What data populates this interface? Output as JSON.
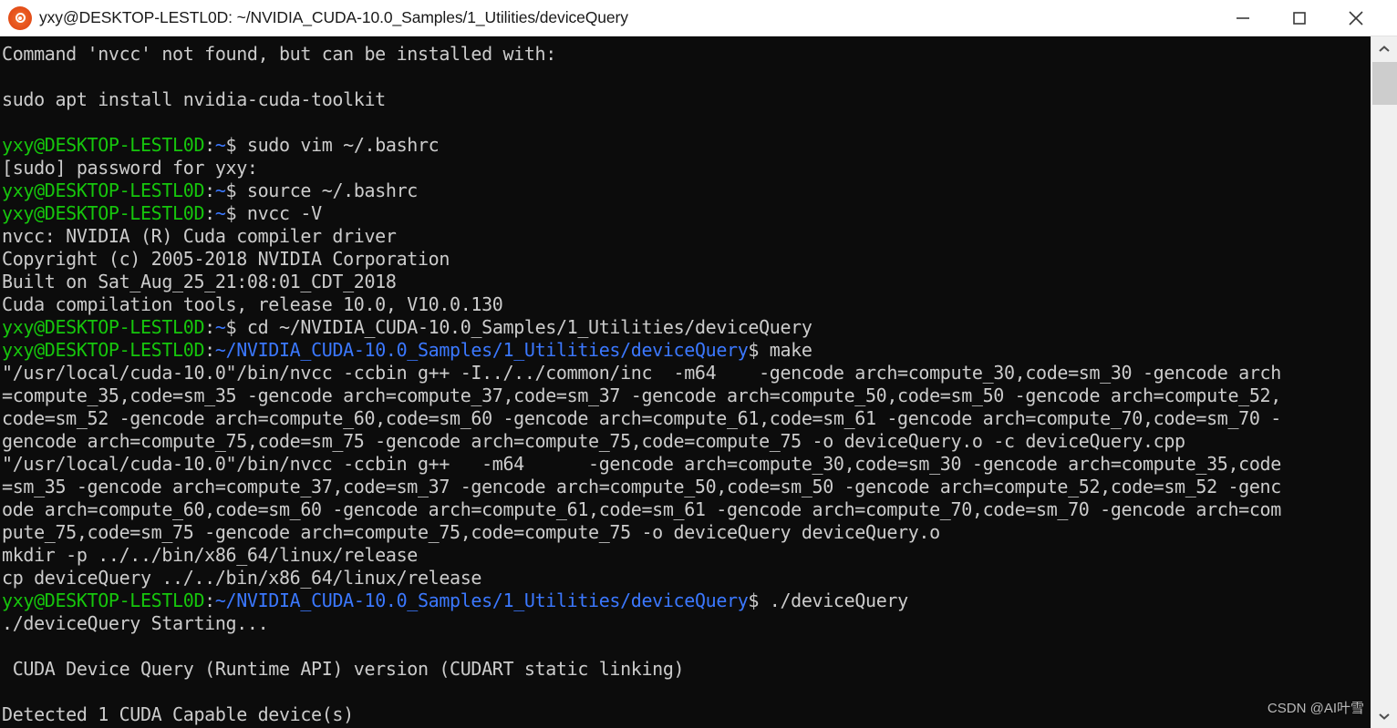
{
  "window": {
    "title": "yxy@DESKTOP-LESTL0D: ~/NVIDIA_CUDA-10.0_Samples/1_Utilities/deviceQuery",
    "icon": "ubuntu-icon",
    "minimize_label": "—",
    "maximize_label": "□",
    "close_label": "✕"
  },
  "colors": {
    "terminal_bg": "#0c0c0c",
    "text": "#cccccc",
    "prompt_user": "#16c60c",
    "prompt_path": "#3b78ff",
    "titlebar_bg": "#ffffff",
    "accent_orange": "#d98c00"
  },
  "scrollbar": {
    "up_arrow": "chevron-up-icon",
    "down_arrow": "chevron-down-icon",
    "thumb": "scrollbar-thumb"
  },
  "watermark": {
    "text": "CSDN @AI叶雪"
  },
  "terminal": {
    "prompt_user_host": "yxy@DESKTOP-LESTL0D",
    "prompt_home": ":~$ ",
    "prompt_dir_path": "~/NVIDIA_CUDA-10.0_Samples/1_Utilities/deviceQuery",
    "lines": [
      {
        "segments": [
          {
            "t": "Command 'nvcc' not found, but can be installed with:",
            "c": "w"
          }
        ]
      },
      {
        "segments": [
          {
            "t": "",
            "c": "w"
          }
        ]
      },
      {
        "segments": [
          {
            "t": "sudo apt install nvidia-cuda-toolkit",
            "c": "w"
          }
        ]
      },
      {
        "segments": [
          {
            "t": "",
            "c": "w"
          }
        ]
      },
      {
        "segments": [
          {
            "t": "yxy@DESKTOP-LESTL0D",
            "c": "g"
          },
          {
            "t": ":",
            "c": "w"
          },
          {
            "t": "~",
            "c": "b"
          },
          {
            "t": "$ sudo vim ~/.bashrc",
            "c": "w"
          }
        ]
      },
      {
        "segments": [
          {
            "t": "[sudo] password for yxy:",
            "c": "w"
          }
        ]
      },
      {
        "segments": [
          {
            "t": "yxy@DESKTOP-LESTL0D",
            "c": "g"
          },
          {
            "t": ":",
            "c": "w"
          },
          {
            "t": "~",
            "c": "b"
          },
          {
            "t": "$ source ~/.bashrc",
            "c": "w"
          }
        ]
      },
      {
        "segments": [
          {
            "t": "yxy@DESKTOP-LESTL0D",
            "c": "g"
          },
          {
            "t": ":",
            "c": "w"
          },
          {
            "t": "~",
            "c": "b"
          },
          {
            "t": "$ nvcc -V",
            "c": "w"
          }
        ]
      },
      {
        "segments": [
          {
            "t": "nvcc: NVIDIA (R) Cuda compiler driver",
            "c": "w"
          }
        ]
      },
      {
        "segments": [
          {
            "t": "Copyright (c) 2005-2018 NVIDIA Corporation",
            "c": "w"
          }
        ]
      },
      {
        "segments": [
          {
            "t": "Built on Sat_Aug_25_21:08:01_CDT_2018",
            "c": "w"
          }
        ]
      },
      {
        "segments": [
          {
            "t": "Cuda compilation tools, release 10.0, V10.0.130",
            "c": "w"
          }
        ]
      },
      {
        "segments": [
          {
            "t": "yxy@DESKTOP-LESTL0D",
            "c": "g"
          },
          {
            "t": ":",
            "c": "w"
          },
          {
            "t": "~",
            "c": "b"
          },
          {
            "t": "$ cd ~/NVIDIA_CUDA-10.0_Samples/1_Utilities/deviceQuery",
            "c": "w"
          }
        ]
      },
      {
        "segments": [
          {
            "t": "yxy@DESKTOP-LESTL0D",
            "c": "g"
          },
          {
            "t": ":",
            "c": "w"
          },
          {
            "t": "~/NVIDIA_CUDA-10.0_Samples/1_Utilities/deviceQuery",
            "c": "b"
          },
          {
            "t": "$ make",
            "c": "w"
          }
        ]
      },
      {
        "segments": [
          {
            "t": "\"/usr/local/cuda-10.0\"/bin/nvcc -ccbin g++ -I../../common/inc  -m64    -gencode arch=compute_30,code=sm_30 -gencode arch",
            "c": "w"
          }
        ]
      },
      {
        "segments": [
          {
            "t": "=compute_35,code=sm_35 -gencode arch=compute_37,code=sm_37 -gencode arch=compute_50,code=sm_50 -gencode arch=compute_52,",
            "c": "w"
          }
        ]
      },
      {
        "segments": [
          {
            "t": "code=sm_52 -gencode arch=compute_60,code=sm_60 -gencode arch=compute_61,code=sm_61 -gencode arch=compute_70,code=sm_70 -",
            "c": "w"
          }
        ]
      },
      {
        "segments": [
          {
            "t": "gencode arch=compute_75,code=sm_75 -gencode arch=compute_75,code=compute_75 -o deviceQuery.o -c deviceQuery.cpp",
            "c": "w"
          }
        ]
      },
      {
        "segments": [
          {
            "t": "\"/usr/local/cuda-10.0\"/bin/nvcc -ccbin g++   -m64      -gencode arch=compute_30,code=sm_30 -gencode arch=compute_35,code",
            "c": "w"
          }
        ]
      },
      {
        "segments": [
          {
            "t": "=sm_35 -gencode arch=compute_37,code=sm_37 -gencode arch=compute_50,code=sm_50 -gencode arch=compute_52,code=sm_52 -genc",
            "c": "w"
          }
        ]
      },
      {
        "segments": [
          {
            "t": "ode arch=compute_60,code=sm_60 -gencode arch=compute_61,code=sm_61 -gencode arch=compute_70,code=sm_70 -gencode arch=com",
            "c": "w"
          }
        ]
      },
      {
        "segments": [
          {
            "t": "pute_75,code=sm_75 -gencode arch=compute_75,code=compute_75 -o deviceQuery deviceQuery.o",
            "c": "w"
          }
        ]
      },
      {
        "segments": [
          {
            "t": "mkdir -p ../../bin/x86_64/linux/release",
            "c": "w"
          }
        ]
      },
      {
        "segments": [
          {
            "t": "cp deviceQuery ../../bin/x86_64/linux/release",
            "c": "w"
          }
        ]
      },
      {
        "segments": [
          {
            "t": "yxy@DESKTOP-LESTL0D",
            "c": "g"
          },
          {
            "t": ":",
            "c": "w"
          },
          {
            "t": "~/NVIDIA_CUDA-10.0_Samples/1_Utilities/deviceQuery",
            "c": "b"
          },
          {
            "t": "$ ./deviceQuery",
            "c": "w"
          }
        ]
      },
      {
        "segments": [
          {
            "t": "./deviceQuery Starting...",
            "c": "w"
          }
        ]
      },
      {
        "segments": [
          {
            "t": "",
            "c": "w"
          }
        ]
      },
      {
        "segments": [
          {
            "t": " CUDA Device Query (Runtime API) version (CUDART static linking)",
            "c": "w"
          }
        ]
      },
      {
        "segments": [
          {
            "t": "",
            "c": "w"
          }
        ]
      },
      {
        "segments": [
          {
            "t": "Detected 1 CUDA Capable device(s)",
            "c": "w"
          }
        ]
      }
    ]
  }
}
